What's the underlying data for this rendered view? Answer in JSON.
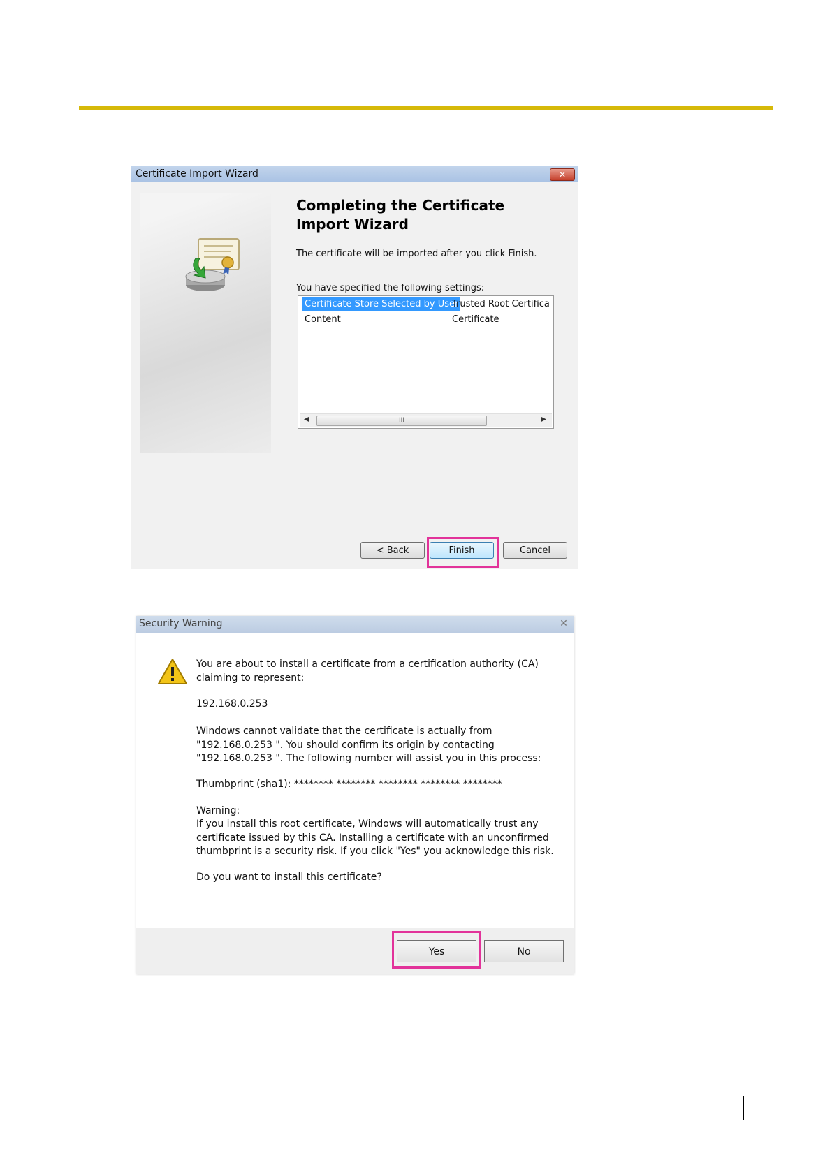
{
  "wizard": {
    "title": "Certificate Import Wizard",
    "heading": "Completing the Certificate Import Wizard",
    "intro": "The certificate will be imported after you click Finish.",
    "settings_label": "You have specified the following settings:",
    "settings": [
      {
        "name": "Certificate Store Selected by User",
        "value": "Trusted Root Certifica"
      },
      {
        "name": "Content",
        "value": "Certificate"
      }
    ],
    "scroll_glyph": "III",
    "buttons": {
      "back": "< Back",
      "finish": "Finish",
      "cancel": "Cancel"
    },
    "close_glyph": "✕"
  },
  "security_warning": {
    "title": "Security Warning",
    "close_glyph": "✕",
    "p1": "You are about to install a certificate from a certification authority (CA) claiming to represent:",
    "address": "192.168.0.253",
    "p2": "Windows cannot validate that the certificate is actually from \"192.168.0.253 \". You should confirm its origin by contacting \"192.168.0.253 \". The following number will assist you in this process:",
    "thumbprint": "Thumbprint (sha1): ******** ******** ******** ******** ********",
    "warning_label": "Warning:",
    "warning_text": "If you install this root certificate, Windows will automatically trust any certificate issued by this CA. Installing a certificate with an unconfirmed thumbprint is a security risk. If you click \"Yes\" you acknowledge this risk.",
    "question": "Do you want to install this certificate?",
    "buttons": {
      "yes": "Yes",
      "no": "No"
    }
  },
  "colors": {
    "rule": "#d6b909",
    "highlight": "#e2339a",
    "selection": "#3399ff"
  }
}
